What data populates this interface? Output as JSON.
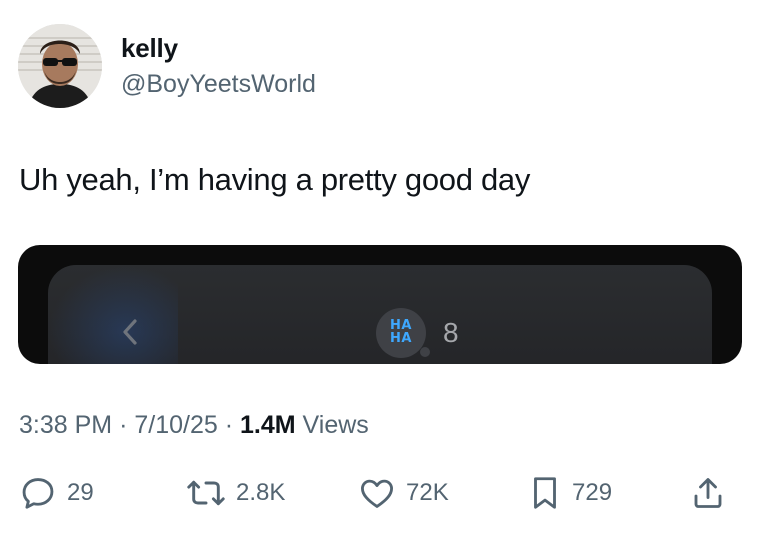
{
  "author": {
    "name": "kelly",
    "handle": "@BoyYeetsWorld"
  },
  "tweet": {
    "text": "Uh yeah, I’m having a pretty good day"
  },
  "media": {
    "reaction_line1": "HA",
    "reaction_line2": "HA",
    "reaction_count": "8"
  },
  "meta": {
    "time": "3:38 PM",
    "sep1": "·",
    "date": "7/10/25",
    "sep2": "·",
    "views_count": "1.4M",
    "views_label": "Views"
  },
  "actions": {
    "replies": "29",
    "retweets": "2.8K",
    "likes": "72K",
    "bookmarks": "729"
  },
  "colors": {
    "text": "#0f1419",
    "secondary": "#536471",
    "haha_blue": "#3ea8ff"
  }
}
